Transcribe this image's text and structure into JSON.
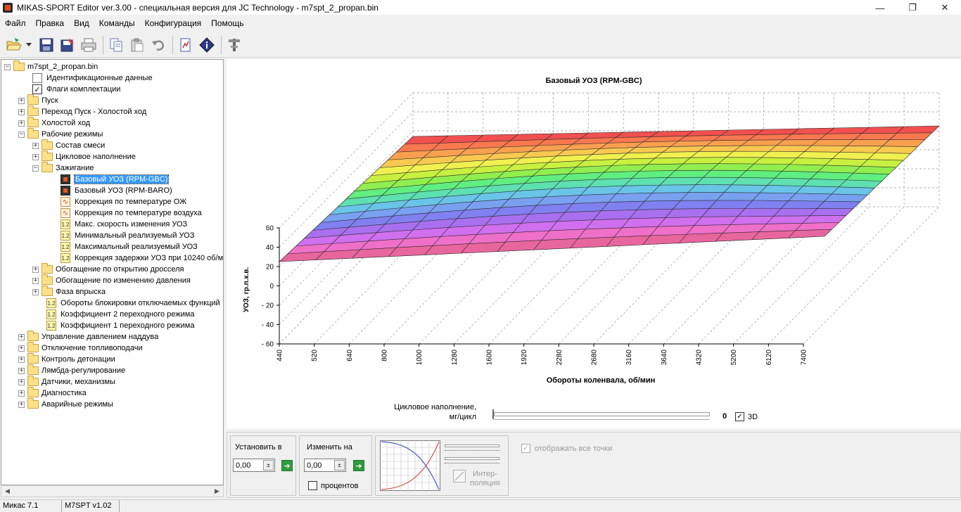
{
  "window": {
    "title": "MIKAS-SPORT Editor ver.3.00 - специальная версия для JC Technology - m7spt_2_propan.bin",
    "minimize": "—",
    "restore": "❐",
    "close": "✕"
  },
  "menu": [
    "Файл",
    "Правка",
    "Вид",
    "Команды",
    "Конфигурация",
    "Помощь"
  ],
  "toolbar": {
    "icons": [
      "open-icon",
      "dropdown-arrow-icon",
      "save-icon",
      "save-as-icon",
      "print-icon",
      "copy-icon",
      "paste-icon",
      "undo-icon",
      "compare-icon",
      "info-icon",
      "tools-icon"
    ]
  },
  "tree": {
    "root": "m7spt_2_propan.bin",
    "items": [
      {
        "label": "Идентификационные данные",
        "icon": "doc",
        "level": 1
      },
      {
        "label": "Флаги комплектации",
        "icon": "check",
        "level": 1
      },
      {
        "label": "Пуск",
        "icon": "folder",
        "level": 1,
        "expander": "+"
      },
      {
        "label": "Переход Пуск - Холостой ход",
        "icon": "folder",
        "level": 1,
        "expander": "+"
      },
      {
        "label": "Холостой ход",
        "icon": "folder",
        "level": 1,
        "expander": "+"
      },
      {
        "label": "Рабочие режимы",
        "icon": "folder",
        "level": 1,
        "expander": "−"
      },
      {
        "label": "Состав смеси",
        "icon": "folder",
        "level": 2,
        "expander": "+"
      },
      {
        "label": "Цикловое наполнение",
        "icon": "folder",
        "level": 2,
        "expander": "+"
      },
      {
        "label": "Зажигание",
        "icon": "folder",
        "level": 2,
        "expander": "−"
      },
      {
        "label": "Базовый УОЗ (RPM-GBC)",
        "icon": "map",
        "level": 3,
        "selected": true
      },
      {
        "label": "Базовый УОЗ (RPM-BARO)",
        "icon": "map",
        "level": 3
      },
      {
        "label": "Коррекция по температуре ОЖ",
        "icon": "curve",
        "level": 3
      },
      {
        "label": "Коррекция по температуре воздуха",
        "icon": "curve",
        "level": 3
      },
      {
        "label": "Макс. скорость изменения УОЗ",
        "icon": "12",
        "level": 3
      },
      {
        "label": "Минимальный реализуемый УОЗ",
        "icon": "12",
        "level": 3
      },
      {
        "label": "Максимальный реализуемый УОЗ",
        "icon": "12",
        "level": 3
      },
      {
        "label": "Коррекция задержки УОЗ при 10240 об/м",
        "icon": "12",
        "level": 3
      },
      {
        "label": "Обогащение по открытию дросселя",
        "icon": "folder",
        "level": 2,
        "expander": "+"
      },
      {
        "label": "Обогащение по изменению давления",
        "icon": "folder",
        "level": 2,
        "expander": "+"
      },
      {
        "label": "Фаза впрыска",
        "icon": "folder",
        "level": 2,
        "expander": "+"
      },
      {
        "label": "Обороты блокировки отключаемых функций",
        "icon": "12",
        "level": 2
      },
      {
        "label": "Коэффициент 2 переходного режима",
        "icon": "12",
        "level": 2
      },
      {
        "label": "Коэффициент 1 переходного режима",
        "icon": "12",
        "level": 2
      },
      {
        "label": "Управление давлением наддува",
        "icon": "folder",
        "level": 1,
        "expander": "+"
      },
      {
        "label": "Отключение топливоподачи",
        "icon": "folder",
        "level": 1,
        "expander": "+"
      },
      {
        "label": "Контроль детонации",
        "icon": "folder",
        "level": 1,
        "expander": "+"
      },
      {
        "label": "Лямбда-регулирование",
        "icon": "folder",
        "level": 1,
        "expander": "+"
      },
      {
        "label": "Датчики, механизмы",
        "icon": "folder",
        "level": 1,
        "expander": "+"
      },
      {
        "label": "Диагностика",
        "icon": "folder",
        "level": 1,
        "expander": "+"
      },
      {
        "label": "Аварийные режимы",
        "icon": "folder",
        "level": 1,
        "expander": "+"
      }
    ]
  },
  "chart_data": {
    "type": "surface",
    "title": "Базовый УОЗ (RPM-GBC)",
    "xlabel": "Обороты коленвала, об/мин",
    "ylabel": "УОЗ, гр.п.к.в.",
    "x": [
      440,
      520,
      640,
      800,
      1000,
      1280,
      1600,
      1920,
      2280,
      2680,
      3160,
      3640,
      4320,
      5200,
      6120,
      7400
    ],
    "y_ticks": [
      60,
      40,
      20,
      0,
      -20,
      -40,
      -60
    ],
    "ylim": [
      -60,
      60
    ],
    "grid": true,
    "band_colors": [
      "#e8669e",
      "#ee70c8",
      "#d070ee",
      "#a870ee",
      "#8080f0",
      "#7aa0f0",
      "#6ac4e8",
      "#5ee0b0",
      "#60ee80",
      "#90ee50",
      "#c8f040",
      "#f0f050",
      "#f8c850",
      "#f8a050",
      "#f87850",
      "#f05050"
    ]
  },
  "slider": {
    "label_line1": "Цикловое наполнение,",
    "label_line2": "мг/цикл",
    "value": "0",
    "check_3d_label": "3D",
    "check_3d": "✓"
  },
  "bottom": {
    "set_label": "Установить в",
    "set_value": "0,00",
    "change_label": "Изменить на",
    "change_value": "0,00",
    "percent_label": "процентов",
    "interp_line1": "Интер-",
    "interp_line2": "поляция",
    "show_all_label": "отображать все точки",
    "show_all_check": "✓",
    "spin": "±",
    "go": "➔"
  },
  "status": [
    "Микас 7.1",
    "M7SPT v1.02"
  ],
  "scroll": {
    "left": "◀",
    "right": "▶"
  }
}
